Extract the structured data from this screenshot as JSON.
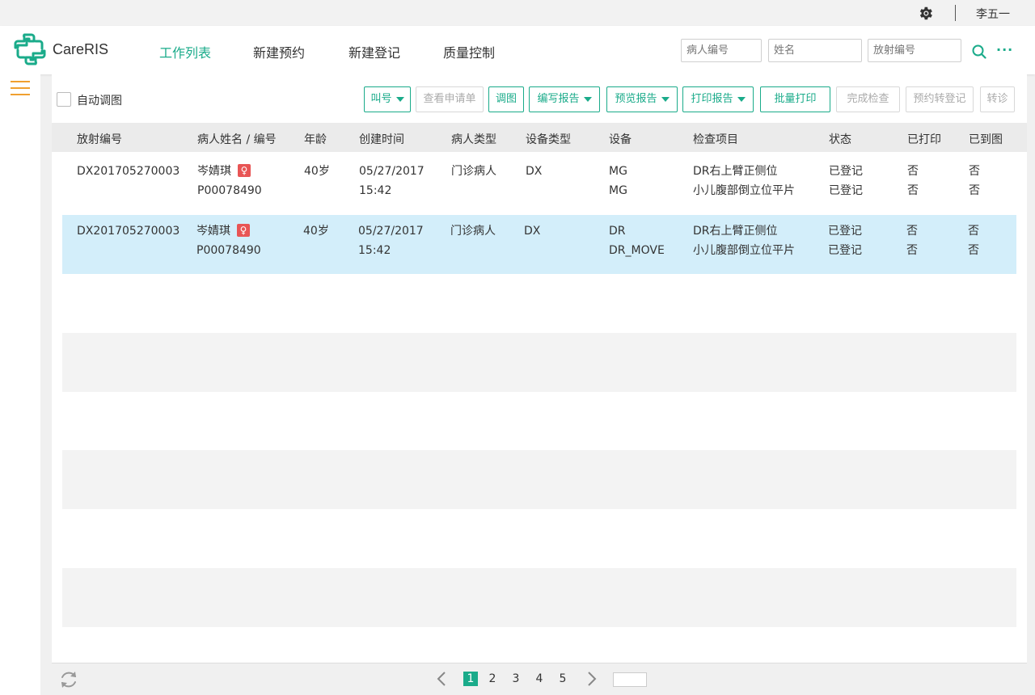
{
  "top": {
    "username": "李五一"
  },
  "app": {
    "name": "CareRIS",
    "accent": "#1aab8a"
  },
  "nav": [
    {
      "label": "工作列表",
      "active": true
    },
    {
      "label": "新建预约"
    },
    {
      "label": "新建登记"
    },
    {
      "label": "质量控制"
    }
  ],
  "search": {
    "patient_id_placeholder": "病人编号",
    "name_placeholder": "姓名",
    "radiology_id_placeholder": "放射编号"
  },
  "toolbar": {
    "auto_label": "自动调图",
    "buttons": {
      "call": "叫号",
      "view_request": "查看申请单",
      "load_image": "调图",
      "write_report": "编写报告",
      "preview_report": "预览报告",
      "print_report": "打印报告",
      "batch_print": "批量打印",
      "complete_exam": "完成检查",
      "appt_to_reg": "预约转登记",
      "transfer": "转诊"
    }
  },
  "table": {
    "headers": [
      "放射编号",
      "病人姓名 / 编号",
      "年龄",
      "创建时间",
      "病人类型",
      "设备类型",
      "设备",
      "检查项目",
      "状态",
      "已打印",
      "已到图"
    ],
    "rows": [
      {
        "rad_id": "DX201705270003",
        "name": "岑婧琪",
        "gender_icon": "♀",
        "patient_id": "P00078490",
        "age": "40岁",
        "date": "05/27/2017",
        "time": "15:42",
        "patient_type": "门诊病人",
        "modality": "DX",
        "device1": "MG",
        "device2": "MG",
        "item1": "DR右上臂正侧位",
        "item2": "小儿腹部倒立位平片",
        "status1": "已登记",
        "status2": "已登记",
        "printed1": "否",
        "printed2": "否",
        "arrived1": "否",
        "arrived2": "否"
      },
      {
        "rad_id": "DX201705270003",
        "name": "岑婧琪",
        "gender_icon": "♀",
        "patient_id": "P00078490",
        "age": "40岁",
        "date": "05/27/2017",
        "time": "15:42",
        "patient_type": "门诊病人",
        "modality": "DX",
        "device1": "DR",
        "device2": "DR_MOVE",
        "item1": "DR右上臂正侧位",
        "item2": "小儿腹部倒立位平片",
        "status1": "已登记",
        "status2": "已登记",
        "printed1": "否",
        "printed2": "否",
        "arrived1": "否",
        "arrived2": "否"
      }
    ]
  },
  "pagination": {
    "pages": [
      "1",
      "2",
      "3",
      "4",
      "5"
    ],
    "current": "1"
  }
}
